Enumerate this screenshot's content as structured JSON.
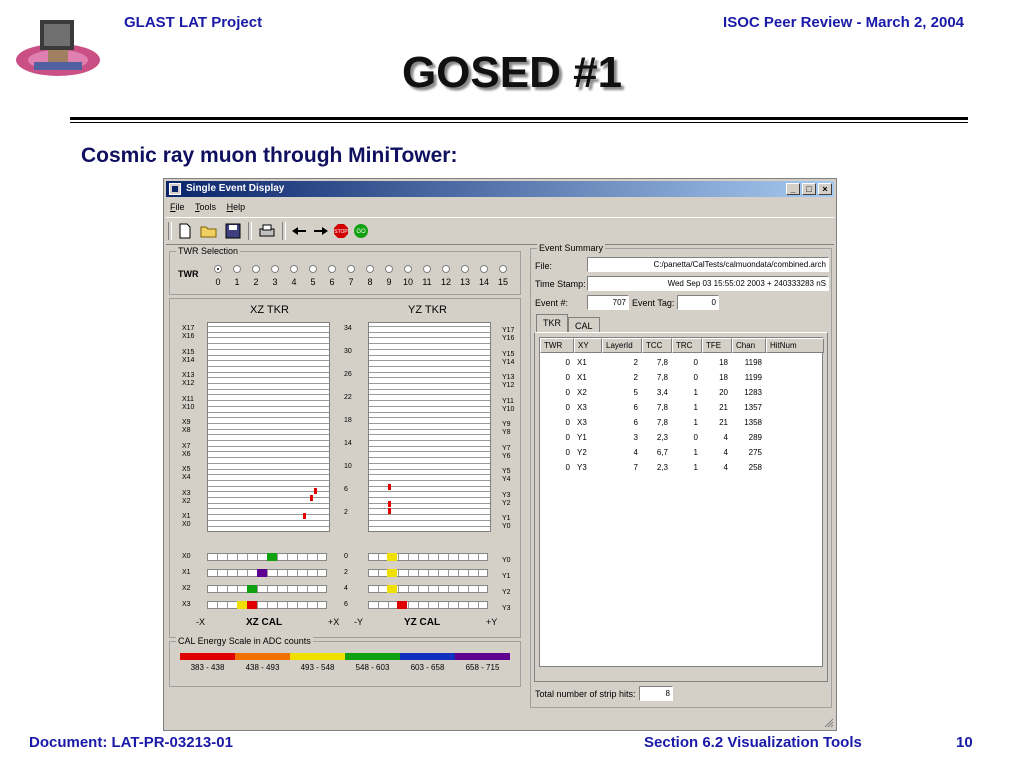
{
  "slide": {
    "header_left": "GLAST LAT Project",
    "header_right": "ISOC Peer Review -  March 2, 2004",
    "title": "GOSED #1",
    "subtitle": "Cosmic ray muon through MiniTower:",
    "footer_document": "Document:  LAT-PR-03213-01",
    "footer_section": "Section 6.2  Visualization Tools",
    "footer_page": "10"
  },
  "window": {
    "title": "Single Event Display",
    "menu": [
      "File",
      "Tools",
      "Help"
    ],
    "toolbar_icons": [
      "new-file-icon",
      "open-folder-icon",
      "save-icon",
      "print-icon",
      "back-arrow-icon",
      "forward-arrow-icon",
      "stop-icon",
      "go-icon"
    ]
  },
  "twr_selection": {
    "label": "TWR Selection",
    "row_label": "TWR",
    "options": [
      "0",
      "1",
      "2",
      "3",
      "4",
      "5",
      "6",
      "7",
      "8",
      "9",
      "10",
      "11",
      "12",
      "13",
      "14",
      "15"
    ],
    "selected": 0
  },
  "tkr": {
    "xz_title": "XZ TKR",
    "yz_title": "YZ TKR",
    "x_labels": [
      "X17",
      "X16",
      "X15",
      "X14",
      "X13",
      "X12",
      "X11",
      "X10",
      "X9",
      "X8",
      "X7",
      "X6",
      "X5",
      "X4",
      "X3",
      "X2",
      "X1",
      "X0"
    ],
    "y_labels": [
      "Y17",
      "Y16",
      "Y15",
      "Y14",
      "Y13",
      "Y12",
      "Y11",
      "Y10",
      "Y9",
      "Y8",
      "Y7",
      "Y6",
      "Y5",
      "Y4",
      "Y3",
      "Y2",
      "Y1",
      "Y0"
    ],
    "z_labels": [
      "34",
      "30",
      "26",
      "22",
      "18",
      "14",
      "10",
      "6",
      "2"
    ]
  },
  "cal": {
    "x_labels": [
      "X0",
      "X1",
      "X2",
      "X3"
    ],
    "y_labels": [
      "Y0",
      "Y1",
      "Y2",
      "Y3"
    ],
    "z_labels": [
      "0",
      "2",
      "4",
      "6"
    ],
    "xz_title": "XZ CAL",
    "yz_title": "YZ CAL",
    "x_minus": "-X",
    "x_plus": "+X",
    "y_minus": "-Y",
    "y_plus": "+Y"
  },
  "cal_scale": {
    "label": "CAL Energy Scale in ADC counts",
    "bins": [
      {
        "label": "383 - 438",
        "color": "#e00000"
      },
      {
        "label": "438 - 493",
        "color": "#f07000"
      },
      {
        "label": "493 - 548",
        "color": "#f0e000"
      },
      {
        "label": "548 - 603",
        "color": "#10a010"
      },
      {
        "label": "603 - 658",
        "color": "#1030c0"
      },
      {
        "label": "658 - 715",
        "color": "#600090"
      }
    ]
  },
  "event_summary": {
    "label": "Event Summary",
    "file_label": "File:",
    "file_value": "C:/panetta/CalTests/calmuondata/combined.arch",
    "time_label": "Time Stamp:",
    "time_value": "Wed Sep 03 15:55:02 2003 + 240333283 nS",
    "event_label": "Event #:",
    "event_value": "707",
    "tag_label": "Event Tag:",
    "tag_value": "0",
    "tabs": [
      "TKR",
      "CAL"
    ],
    "active_tab": "TKR",
    "columns": [
      "TWR",
      "XY",
      "LayerId",
      "TCC",
      "TRC",
      "TFE",
      "Chan",
      "HitNum"
    ],
    "rows": [
      [
        "0",
        "X1",
        "2",
        "7,8",
        "0",
        "18",
        "1198"
      ],
      [
        "0",
        "X1",
        "2",
        "7,8",
        "0",
        "18",
        "1199"
      ],
      [
        "0",
        "X2",
        "5",
        "3,4",
        "1",
        "20",
        "1283"
      ],
      [
        "0",
        "X3",
        "6",
        "7,8",
        "1",
        "21",
        "1357"
      ],
      [
        "0",
        "X3",
        "6",
        "7,8",
        "1",
        "21",
        "1358"
      ],
      [
        "0",
        "Y1",
        "3",
        "2,3",
        "0",
        "4",
        "289"
      ],
      [
        "0",
        "Y2",
        "4",
        "6,7",
        "1",
        "4",
        "275"
      ],
      [
        "0",
        "Y3",
        "7",
        "2,3",
        "1",
        "4",
        "258"
      ]
    ],
    "total_label": "Total number of strip hits:",
    "total_value": "8"
  }
}
